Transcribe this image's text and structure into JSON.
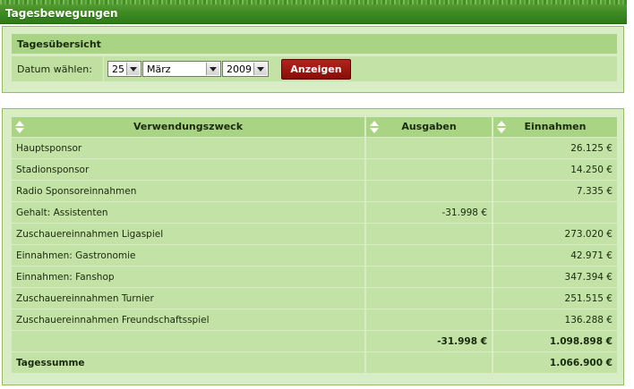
{
  "header": {
    "title": "Tagesbewegungen"
  },
  "overview": {
    "title": "Tagesübersicht",
    "date_label": "Datum wählen:",
    "day": "25",
    "month": "März",
    "year": "2009",
    "show_button": "Anzeigen"
  },
  "table": {
    "columns": [
      "Verwendungszweck",
      "Ausgaben",
      "Einnahmen"
    ],
    "rows": [
      {
        "purpose": "Hauptsponsor",
        "expenses": "",
        "income": "26.125 €"
      },
      {
        "purpose": "Stadionsponsor",
        "expenses": "",
        "income": "14.250 €"
      },
      {
        "purpose": "Radio Sponsoreinnahmen",
        "expenses": "",
        "income": "7.335 €"
      },
      {
        "purpose": "Gehalt: Assistenten",
        "expenses": "-31.998 €",
        "income": ""
      },
      {
        "purpose": "Zuschauereinnahmen Ligaspiel",
        "expenses": "",
        "income": "273.020 €"
      },
      {
        "purpose": "Einnahmen: Gastronomie",
        "expenses": "",
        "income": "42.971 €"
      },
      {
        "purpose": "Einnahmen: Fanshop",
        "expenses": "",
        "income": "347.394 €"
      },
      {
        "purpose": "Zuschauereinnahmen Turnier",
        "expenses": "",
        "income": "251.515 €"
      },
      {
        "purpose": "Zuschauereinnahmen Freundschaftsspiel",
        "expenses": "",
        "income": "136.288 €"
      }
    ],
    "totals": {
      "purpose": "",
      "expenses": "-31.998 €",
      "income": "1.098.898 €"
    },
    "day_sum": {
      "purpose": "Tagessumme",
      "expenses": "",
      "income": "1.066.900 €"
    }
  },
  "colors": {
    "header_green": "#3e8a22",
    "panel_bg": "#d8ecc5",
    "row_bg": "#c3e2a6",
    "head_bg": "#a9d483",
    "button_red": "#9a1510"
  }
}
